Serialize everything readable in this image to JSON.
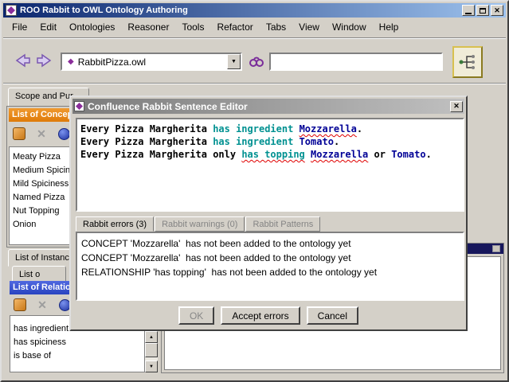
{
  "window": {
    "title": "ROO Rabbit to OWL Ontology Authoring"
  },
  "icons": {
    "diamond": "◆",
    "down": "▼",
    "up": "▲",
    "close": "✕"
  },
  "colors": {
    "rel": "#009191",
    "con": "#000096",
    "orange1": "#f09a30",
    "orange2": "#df7a08",
    "blue1": "#5068e0",
    "blue2": "#2844c0"
  },
  "menu": {
    "items": [
      "File",
      "Edit",
      "Ontologies",
      "Reasoner",
      "Tools",
      "Refactor",
      "Tabs",
      "View",
      "Window",
      "Help"
    ]
  },
  "toolbar": {
    "ontology": "RabbitPizza.owl",
    "search_value": ""
  },
  "left": {
    "scope_tab": "Scope and Pur",
    "concepts": {
      "header": "List of Concep",
      "items": [
        "Meaty Pizza",
        "Medium Spicin",
        "Mild Spiciness",
        "Named Pizza",
        "Nut Topping",
        "Onion"
      ]
    },
    "instances_tab": "List of Instanc",
    "sub_tab": "List o",
    "relations": {
      "header": "List of Relation",
      "items": [
        "has ingredient",
        "has spiciness",
        "is base of"
      ]
    }
  },
  "dialog": {
    "title": "Confluence Rabbit Sentence Editor",
    "editor_lines": [
      [
        {
          "t": "Every ",
          "c": "kw"
        },
        {
          "t": "Pizza Margherita ",
          "c": "txt"
        },
        {
          "t": "has ingredient",
          "c": "rel"
        },
        {
          "t": " ",
          "c": "txt"
        },
        {
          "t": "Mozzarella",
          "c": "con err"
        },
        {
          "t": ".",
          "c": "txt"
        }
      ],
      [
        {
          "t": "Every ",
          "c": "kw"
        },
        {
          "t": "Pizza Margherita ",
          "c": "txt"
        },
        {
          "t": "has ingredient",
          "c": "rel"
        },
        {
          "t": " ",
          "c": "txt"
        },
        {
          "t": "Tomato",
          "c": "con"
        },
        {
          "t": ".",
          "c": "txt"
        }
      ],
      [
        {
          "t": "Every ",
          "c": "kw"
        },
        {
          "t": "Pizza Margherita ",
          "c": "txt"
        },
        {
          "t": "only ",
          "c": "kw"
        },
        {
          "t": "has topping",
          "c": "rel err"
        },
        {
          "t": " ",
          "c": "txt"
        },
        {
          "t": "Mozzarella",
          "c": "con err"
        },
        {
          "t": " ",
          "c": "txt"
        },
        {
          "t": "or",
          "c": "kw"
        },
        {
          "t": " ",
          "c": "txt"
        },
        {
          "t": "Tomato",
          "c": "con"
        },
        {
          "t": ".",
          "c": "txt"
        }
      ]
    ],
    "tabs": [
      {
        "label": "Rabbit errors (3)",
        "active": true
      },
      {
        "label": "Rabbit warnings (0)",
        "active": false
      },
      {
        "label": "Rabbit Patterns",
        "active": false
      }
    ],
    "errors": [
      "CONCEPT 'Mozzarella'  has not been added to the ontology yet",
      "CONCEPT 'Mozzarella'  has not been added to the ontology yet",
      "RELATIONSHIP 'has topping'  has not been added to the ontology yet"
    ],
    "buttons": [
      {
        "label": "OK",
        "disabled": true
      },
      {
        "label": "Accept errors",
        "disabled": false
      },
      {
        "label": "Cancel",
        "disabled": false
      }
    ]
  }
}
